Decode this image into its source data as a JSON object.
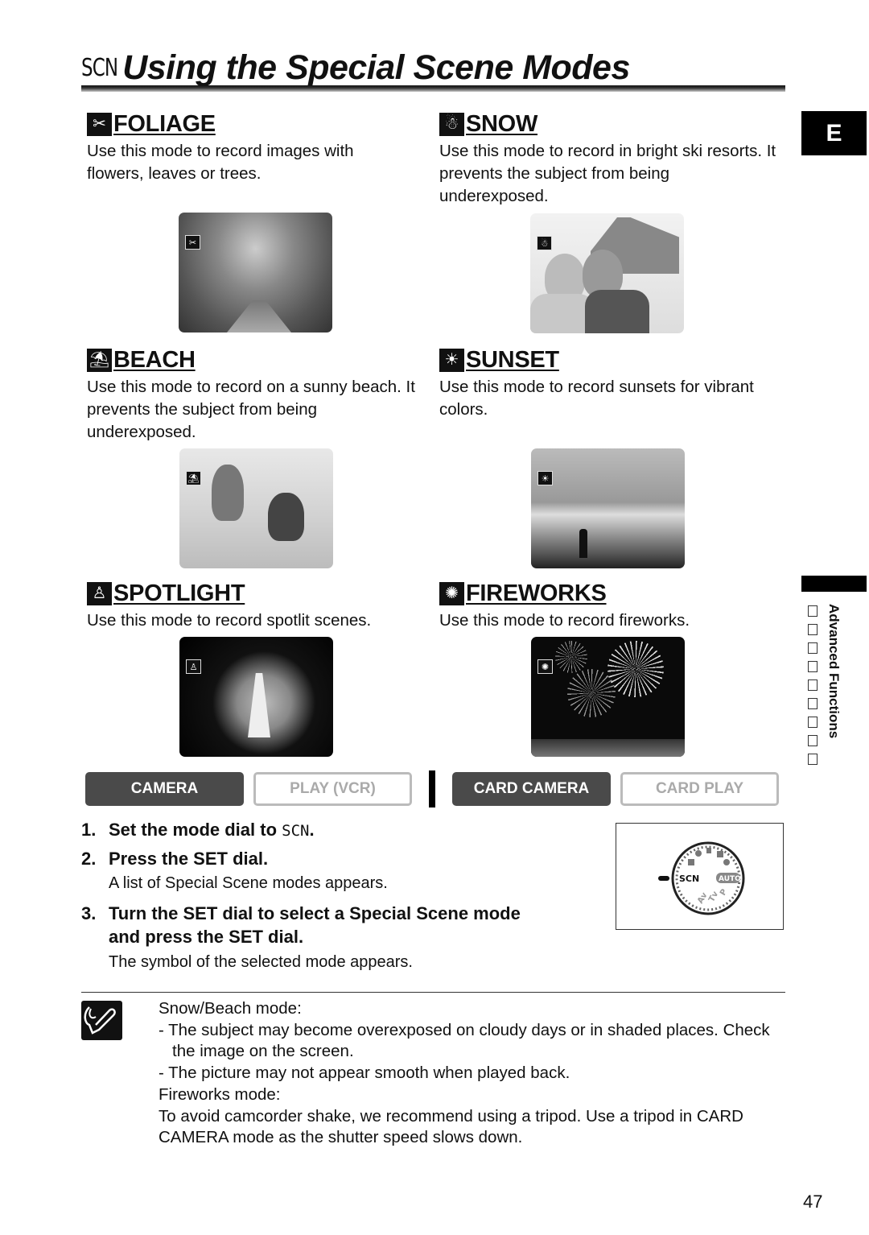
{
  "header": {
    "scn_symbol": "SCN",
    "title": "Using the Special Scene Modes"
  },
  "lang_tab": "E",
  "side_tab": {
    "label": "Advanced Functions",
    "box_count": 9
  },
  "modes": [
    {
      "id": "foliage",
      "icon": "foliage-icon",
      "glyph": "✂",
      "name": "FOLIAGE",
      "description": "Use this mode to record images with flowers, leaves or trees.",
      "photo": "forest path with trees"
    },
    {
      "id": "snow",
      "icon": "snowman-icon",
      "glyph": "☃",
      "name": "SNOW",
      "description": "Use this mode to record in bright ski resorts. It prevents the subject from being underexposed.",
      "photo": "two children in snow in front of a cabin"
    },
    {
      "id": "beach",
      "icon": "beach-umbrella-icon",
      "glyph": "⛱",
      "name": "BEACH",
      "description": "Use this mode to record on a sunny beach. It prevents the subject from being underexposed.",
      "photo": "children playing in sand"
    },
    {
      "id": "sunset",
      "icon": "sunset-icon",
      "glyph": "☀",
      "name": "SUNSET",
      "description": "Use this mode to record sunsets for vibrant colors.",
      "photo": "person walking on beach at sunset"
    },
    {
      "id": "spotlight",
      "icon": "spotlight-icon",
      "glyph": "♙",
      "name": "SPOTLIGHT",
      "description": "Use this mode to record spotlit scenes.",
      "photo": "performer on stage under spotlight"
    },
    {
      "id": "fireworks",
      "icon": "fireworks-icon",
      "glyph": "✺",
      "name": "FIREWORKS",
      "description": "Use this mode to record fireworks.",
      "photo": "fireworks over city skyline"
    }
  ],
  "mode_buttons": [
    {
      "label": "CAMERA",
      "active": true
    },
    {
      "label": "PLAY (VCR)",
      "active": false
    },
    {
      "label": "CARD CAMERA",
      "active": true
    },
    {
      "label": "CARD PLAY",
      "active": false
    }
  ],
  "steps": [
    {
      "num": "1.",
      "text": "Set the mode dial to ",
      "symbol": "SCN",
      "suffix": ".",
      "note": ""
    },
    {
      "num": "2.",
      "text": "Press the SET dial.",
      "note": "A list of Special Scene modes appears."
    },
    {
      "num": "3.",
      "text": "Turn the SET dial to select a Special Scene mode",
      "text2": "and press the SET dial.",
      "note": "The symbol of the selected mode appears."
    }
  ],
  "dial": {
    "position_label": "SCN",
    "auto_label": "AUTO",
    "other_labels": [
      "Av",
      "Tv",
      "P"
    ]
  },
  "notes": {
    "heading1": "Snow/Beach mode:",
    "item1": "- The subject may become overexposed on cloudy days or in shaded places. Check the image on the screen.",
    "item2": "- The picture may not appear smooth when played back.",
    "heading2": "Fireworks mode:",
    "para": "To avoid camcorder shake, we recommend using a tripod. Use a tripod in CARD CAMERA mode as the shutter speed slows down."
  },
  "page_number": "47"
}
